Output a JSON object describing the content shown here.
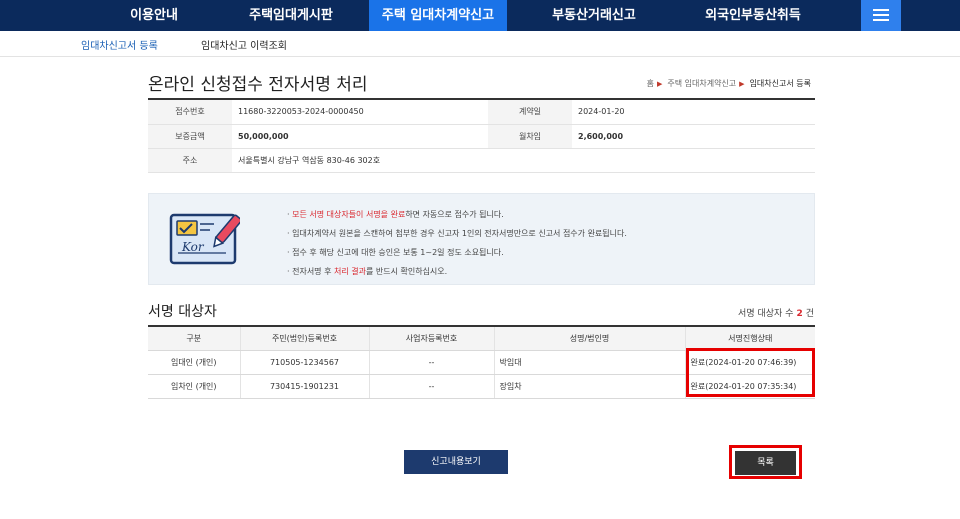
{
  "topnav": {
    "items": [
      {
        "label": "이용안내"
      },
      {
        "label": "주택임대게시판"
      },
      {
        "label": "주택 임대차계약신고"
      },
      {
        "label": "부동산거래신고"
      },
      {
        "label": "외국인부동산취득"
      }
    ],
    "menu_icon": "hamburger-icon",
    "bg_color": "#0b2a5c",
    "active_color": "#1a73e8"
  },
  "subnav": {
    "items": [
      {
        "label": "임대차신고서 등록"
      },
      {
        "label": "임대차신고 이력조회"
      }
    ]
  },
  "page": {
    "title": "온라인 신청접수 전자서명 처리",
    "breadcrumb": [
      "홈",
      "주택 임대차계약신고",
      "임대차신고서 등록"
    ]
  },
  "info": {
    "receipt_no_label": "접수번호",
    "receipt_no": "11680-3220053-2024-0000450",
    "contract_date_label": "계약일",
    "contract_date": "2024-01-20",
    "deposit_label": "보증금액",
    "deposit": "50,000,000",
    "monthly_rent_label": "월차임",
    "monthly_rent": "2,600,000",
    "address_label": "주소",
    "address": "서울특별시 강남구 역삼동 830-46 302호"
  },
  "notice": {
    "card_text": "Kor",
    "line1_red": "모든 서명 대상자들이 서명을 완료",
    "line1_rest": "하면 자동으로 접수가 됩니다.",
    "line2": "임대차계약서 원본을 스캔하여 첨부한 경우 신고자 1인의 전자서명만으로 신고서 접수가 완료됩니다.",
    "line3": "접수 후 해당 신고에 대한 승인은 보통 1~2일 정도 소요됩니다.",
    "line4_pre": "전자서명 후 ",
    "line4_red": "처리 결과",
    "line4_post": "를 반드시 확인하십시오."
  },
  "signers": {
    "section_title": "서명 대상자",
    "count_label": "서명 대상자 수",
    "count": "2",
    "count_unit": "건",
    "headers": [
      "구분",
      "주민(법인)등록번호",
      "사업자등록번호",
      "성명/법인명",
      "서명진행상태"
    ],
    "rows": [
      {
        "type": "임대인 (개인)",
        "reg_no": "710505-1234567",
        "biz_no": "--",
        "name": "박임대",
        "status": "완료(2024-01-20 07:46:39)"
      },
      {
        "type": "임차인 (개인)",
        "reg_no": "730415-1901231",
        "biz_no": "--",
        "name": "장임차",
        "status": "완료(2024-01-20 07:35:34)"
      }
    ]
  },
  "buttons": {
    "view_report": "신고내용보기",
    "list": "목록"
  }
}
